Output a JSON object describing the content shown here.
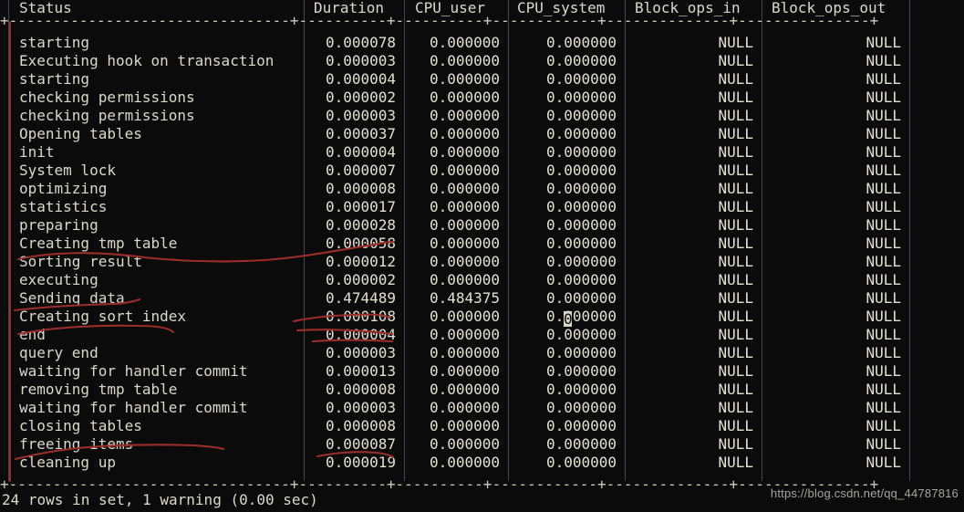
{
  "terminal": {
    "background": "#0b0b0b",
    "foreground": "#ddd8cb",
    "annotation_color": "#9e2f2b",
    "border_color": "#3f4a5a"
  },
  "table": {
    "headers": [
      "Status",
      "Duration",
      "CPU_user",
      "CPU_system",
      "Block_ops_in",
      "Block_ops_out"
    ],
    "separator_top": "+--------------------------------+----------+----------+------------+--------------+---------------+",
    "separator_bottom": "+--------------------------------+----------+----------+------------+--------------+---------------+",
    "rows": [
      {
        "status": "starting",
        "duration": "0.000078",
        "cpu_user": "0.000000",
        "cpu_system": "0.000000",
        "block_ops_in": "NULL",
        "block_ops_out": "NULL"
      },
      {
        "status": "Executing hook on transaction",
        "duration": "0.000003",
        "cpu_user": "0.000000",
        "cpu_system": "0.000000",
        "block_ops_in": "NULL",
        "block_ops_out": "NULL"
      },
      {
        "status": "starting",
        "duration": "0.000004",
        "cpu_user": "0.000000",
        "cpu_system": "0.000000",
        "block_ops_in": "NULL",
        "block_ops_out": "NULL"
      },
      {
        "status": "checking permissions",
        "duration": "0.000002",
        "cpu_user": "0.000000",
        "cpu_system": "0.000000",
        "block_ops_in": "NULL",
        "block_ops_out": "NULL"
      },
      {
        "status": "checking permissions",
        "duration": "0.000003",
        "cpu_user": "0.000000",
        "cpu_system": "0.000000",
        "block_ops_in": "NULL",
        "block_ops_out": "NULL"
      },
      {
        "status": "Opening tables",
        "duration": "0.000037",
        "cpu_user": "0.000000",
        "cpu_system": "0.000000",
        "block_ops_in": "NULL",
        "block_ops_out": "NULL"
      },
      {
        "status": "init",
        "duration": "0.000004",
        "cpu_user": "0.000000",
        "cpu_system": "0.000000",
        "block_ops_in": "NULL",
        "block_ops_out": "NULL"
      },
      {
        "status": "System lock",
        "duration": "0.000007",
        "cpu_user": "0.000000",
        "cpu_system": "0.000000",
        "block_ops_in": "NULL",
        "block_ops_out": "NULL"
      },
      {
        "status": "optimizing",
        "duration": "0.000008",
        "cpu_user": "0.000000",
        "cpu_system": "0.000000",
        "block_ops_in": "NULL",
        "block_ops_out": "NULL"
      },
      {
        "status": "statistics",
        "duration": "0.000017",
        "cpu_user": "0.000000",
        "cpu_system": "0.000000",
        "block_ops_in": "NULL",
        "block_ops_out": "NULL"
      },
      {
        "status": "preparing",
        "duration": "0.000028",
        "cpu_user": "0.000000",
        "cpu_system": "0.000000",
        "block_ops_in": "NULL",
        "block_ops_out": "NULL"
      },
      {
        "status": "Creating tmp table",
        "duration": "0.000058",
        "cpu_user": "0.000000",
        "cpu_system": "0.000000",
        "block_ops_in": "NULL",
        "block_ops_out": "NULL"
      },
      {
        "status": "Sorting result",
        "duration": "0.000012",
        "cpu_user": "0.000000",
        "cpu_system": "0.000000",
        "block_ops_in": "NULL",
        "block_ops_out": "NULL"
      },
      {
        "status": "executing",
        "duration": "0.000002",
        "cpu_user": "0.000000",
        "cpu_system": "0.000000",
        "block_ops_in": "NULL",
        "block_ops_out": "NULL"
      },
      {
        "status": "Sending data",
        "duration": "0.474489",
        "cpu_user": "0.484375",
        "cpu_system": "0.000000",
        "block_ops_in": "NULL",
        "block_ops_out": "NULL"
      },
      {
        "status": "Creating sort index",
        "duration": "0.000108",
        "cpu_user": "0.000000",
        "cpu_system": "0.000000",
        "block_ops_in": "NULL",
        "block_ops_out": "NULL"
      },
      {
        "status": "end",
        "duration": "0.000004",
        "cpu_user": "0.000000",
        "cpu_system": "0.000000",
        "block_ops_in": "NULL",
        "block_ops_out": "NULL"
      },
      {
        "status": "query end",
        "duration": "0.000003",
        "cpu_user": "0.000000",
        "cpu_system": "0.000000",
        "block_ops_in": "NULL",
        "block_ops_out": "NULL"
      },
      {
        "status": "waiting for handler commit",
        "duration": "0.000013",
        "cpu_user": "0.000000",
        "cpu_system": "0.000000",
        "block_ops_in": "NULL",
        "block_ops_out": "NULL"
      },
      {
        "status": "removing tmp table",
        "duration": "0.000008",
        "cpu_user": "0.000000",
        "cpu_system": "0.000000",
        "block_ops_in": "NULL",
        "block_ops_out": "NULL"
      },
      {
        "status": "waiting for handler commit",
        "duration": "0.000003",
        "cpu_user": "0.000000",
        "cpu_system": "0.000000",
        "block_ops_in": "NULL",
        "block_ops_out": "NULL"
      },
      {
        "status": "closing tables",
        "duration": "0.000008",
        "cpu_user": "0.000000",
        "cpu_system": "0.000000",
        "block_ops_in": "NULL",
        "block_ops_out": "NULL"
      },
      {
        "status": "freeing items",
        "duration": "0.000087",
        "cpu_user": "0.000000",
        "cpu_system": "0.000000",
        "block_ops_in": "NULL",
        "block_ops_out": "NULL"
      },
      {
        "status": "cleaning up",
        "duration": "0.000019",
        "cpu_user": "0.000000",
        "cpu_system": "0.000000",
        "block_ops_in": "NULL",
        "block_ops_out": "NULL"
      }
    ]
  },
  "footer": {
    "result_line": "24 rows in set, 1 warning (0.00 sec)"
  },
  "watermark": {
    "text": "https://blog.csdn.net/qq_44787816"
  },
  "cursor": {
    "char": "0",
    "column": "CPU_system",
    "row_status": "Creating sort index"
  },
  "annotations": [
    {
      "id": "underline-creating-tmp-table",
      "target": "Creating tmp table"
    },
    {
      "id": "underline-sending-data",
      "target": "Sending data"
    },
    {
      "id": "underline-creating-sort-index",
      "target": "Creating sort index"
    },
    {
      "id": "strike-freeing-items",
      "target": "freeing items"
    },
    {
      "id": "underline-duration-000058",
      "target": "0.000058"
    },
    {
      "id": "underline-duration-000108",
      "target": "0.000108"
    },
    {
      "id": "strike-duration-000004",
      "target": "0.000004"
    },
    {
      "id": "underline-duration-000019",
      "target": "0.000019"
    },
    {
      "id": "vertical-left-margin-mark",
      "target": "left table border"
    }
  ]
}
